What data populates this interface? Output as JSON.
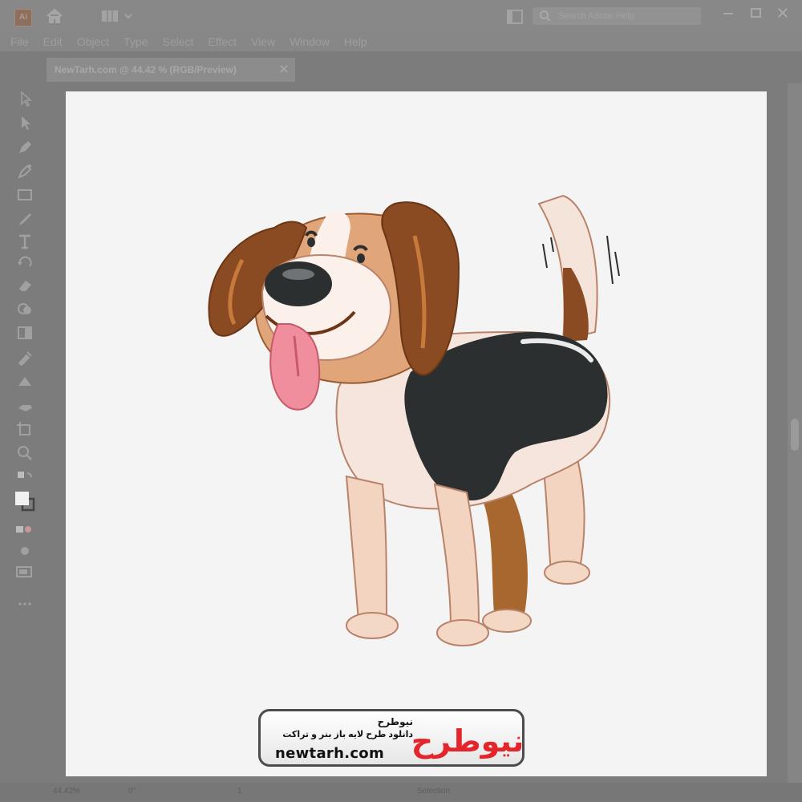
{
  "app": {
    "logo_text": "Ai",
    "search_placeholder": "Search Adobe Help"
  },
  "menu": [
    "File",
    "Edit",
    "Object",
    "Type",
    "Select",
    "Effect",
    "View",
    "Window",
    "Help"
  ],
  "document": {
    "tab_title": "NewTarh.com @ 44.42 % (RGB/Preview)"
  },
  "toolbar": {
    "tools": [
      "selection-tool",
      "direct-selection-tool",
      "pen-tool",
      "curvature-tool",
      "rectangle-tool",
      "paintbrush-tool",
      "type-tool",
      "rotate-tool",
      "eraser-tool",
      "shape-builder-tool",
      "gradient-tool",
      "eyedropper-tool",
      "blend-tool",
      "symbol-sprayer-tool",
      "artboard-tool",
      "hand-tool",
      "zoom-tool"
    ]
  },
  "status": {
    "zoom": "44.42%",
    "rotation": "0°",
    "page": "1",
    "current_tool": "Selection"
  },
  "watermark": {
    "title_fa": "نیوطرح",
    "subtitle_fa": "دانلود طرح لایه باز بنر و تراکت",
    "url": "newtarh.com",
    "logo_text": "نیوطرح"
  },
  "colors": {
    "ui_gray": "#7c7c7c",
    "artboard": "#f4f4f4",
    "dog_brown": "#8a4a22",
    "dog_tan": "#e0a679",
    "dog_black": "#2b2f30",
    "tongue": "#f08e9e",
    "brand_red": "#e3262b"
  }
}
